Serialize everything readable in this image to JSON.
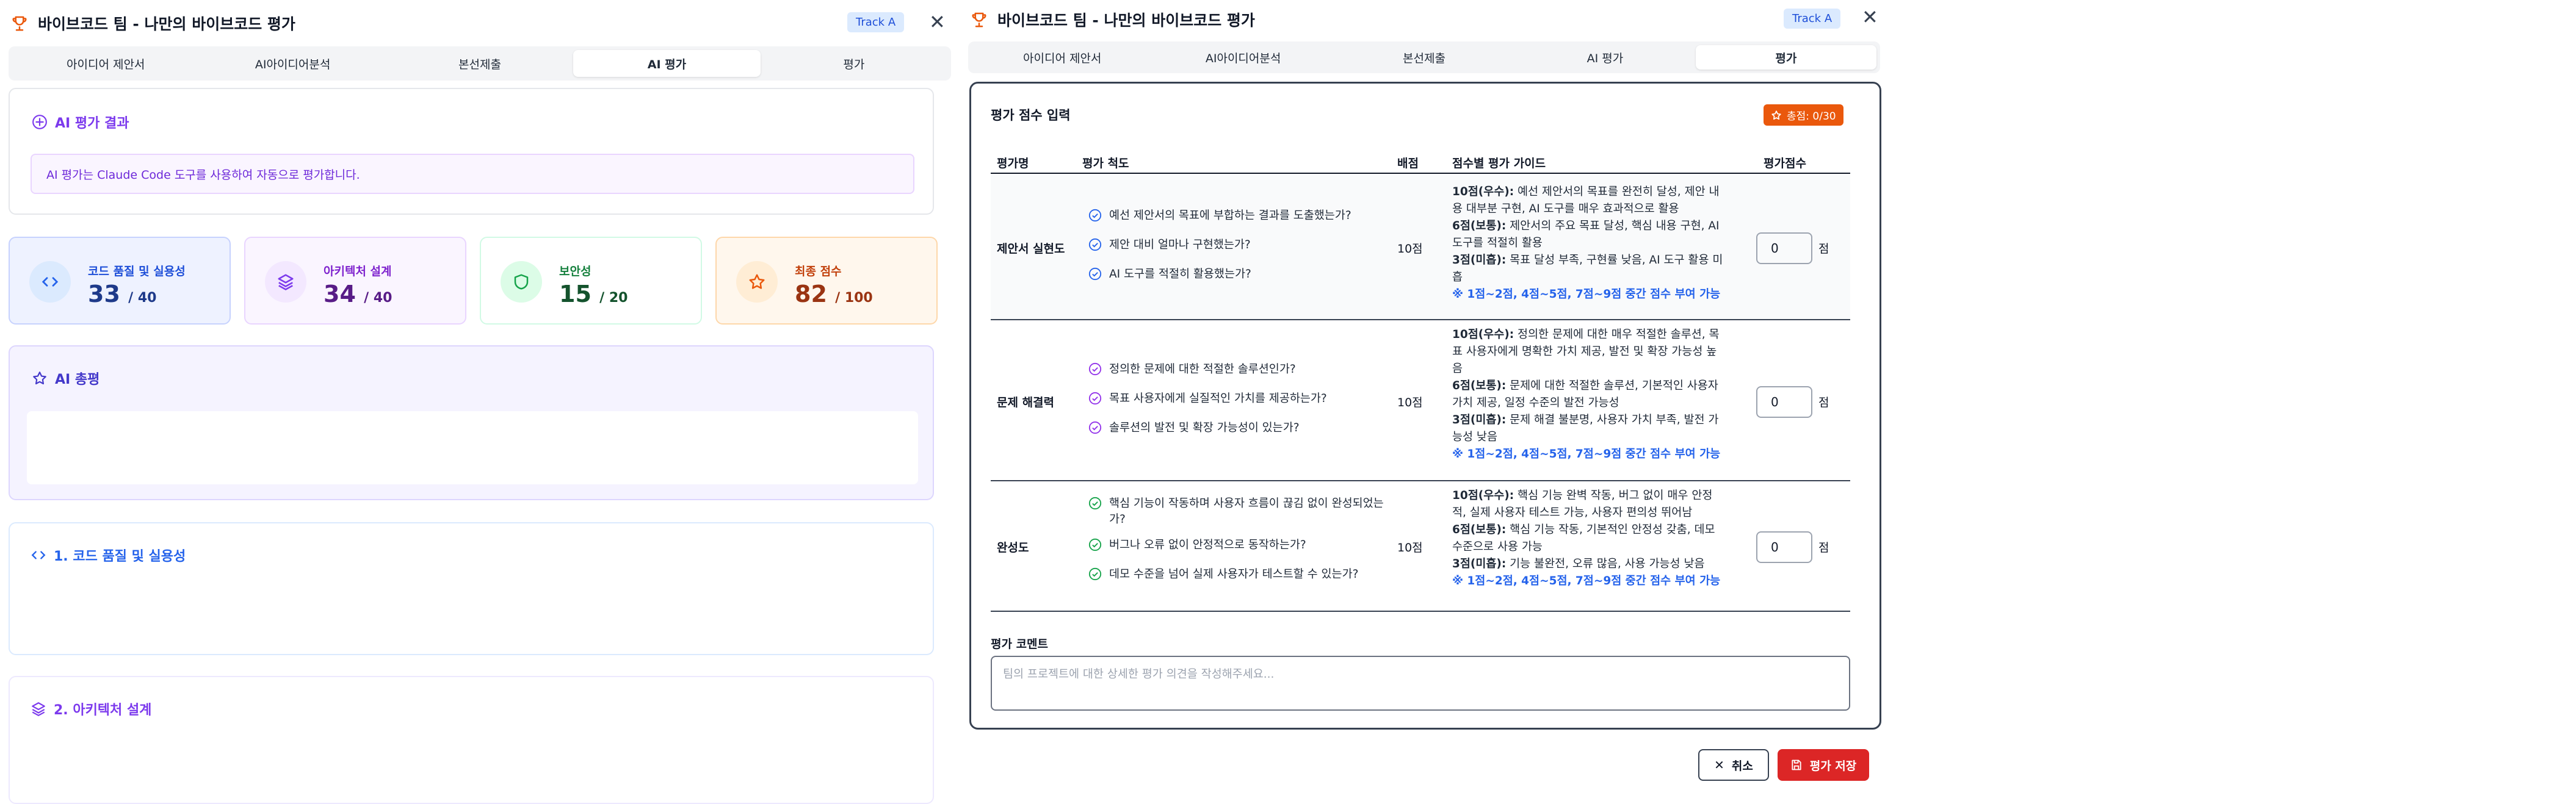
{
  "left": {
    "title": "바이브코드 팀 - 나만의 바이브코드 평가",
    "track": "Track A",
    "tabs": [
      "아이디어 제안서",
      "AI아이디어분석",
      "본선제출",
      "AI 평가",
      "평가"
    ],
    "ai_result": {
      "title": "AI 평가 결과",
      "notice": "AI 평가는 Claude Code 도구를 사용하여 자동으로 평가합니다."
    },
    "metrics": [
      {
        "label": "코드 품질 및 실용성",
        "value": "33",
        "max": "/ 40",
        "icon": "code-icon"
      },
      {
        "label": "아키텍처 설계",
        "value": "34",
        "max": "/ 40",
        "icon": "layers-icon"
      },
      {
        "label": "보안성",
        "value": "15",
        "max": "/ 20",
        "icon": "shield-icon"
      },
      {
        "label": "최종 점수",
        "value": "82",
        "max": "/ 100",
        "icon": "star-icon"
      }
    ],
    "summary_title": "AI 총평",
    "section1_title": "1. 코드 품질 및 실용성",
    "section2_title": "2. 아키텍처 설계"
  },
  "right": {
    "title": "바이브코드 팀 - 나만의 바이브코드 평가",
    "track": "Track A",
    "tabs": [
      "아이디어 제안서",
      "AI아이디어분석",
      "본선제출",
      "AI 평가",
      "평가"
    ],
    "form_title": "평가 점수 입력",
    "total_badge": "총점: 0/30",
    "columns": [
      "평가명",
      "평가 척도",
      "배점",
      "점수별 평가 가이드",
      "평가점수"
    ],
    "rows": [
      {
        "name": "제안서 실현도",
        "criteria": [
          "예선 제안서의 목표에 부합하는 결과를 도출했는가?",
          "제안 대비 얼마나 구현했는가?",
          "AI 도구를 적절히 활용했는가?"
        ],
        "points": "10점",
        "guide": [
          {
            "k": "10점(우수):",
            "t": " 예선 제안서의 목표를 완전히 달성, 제안 내용 대부분 구현, AI 도구를 매우 효과적으로 활용"
          },
          {
            "k": "6점(보통):",
            "t": " 제안서의 주요 목표 달성, 핵심 내용 구현, AI 도구를 적절히 활용"
          },
          {
            "k": "3점(미흡):",
            "t": " 목표 달성 부족, 구현률 낮음, AI 도구 활용 미흡"
          }
        ],
        "note": "※ 1점~2점, 4점~5점, 7점~9점 중간 점수 부여 가능",
        "score": "0",
        "unit": "점"
      },
      {
        "name": "문제 해결력",
        "criteria": [
          "정의한 문제에 대한 적절한 솔루션인가?",
          "목표 사용자에게 실질적인 가치를 제공하는가?",
          "솔루션의 발전 및 확장 가능성이 있는가?"
        ],
        "points": "10점",
        "guide": [
          {
            "k": "10점(우수):",
            "t": " 정의한 문제에 대한 매우 적절한 솔루션, 목표 사용자에게 명확한 가치 제공, 발전 및 확장 가능성 높음"
          },
          {
            "k": "6점(보통):",
            "t": " 문제에 대한 적절한 솔루션, 기본적인 사용자 가치 제공, 일정 수준의 발전 가능성"
          },
          {
            "k": "3점(미흡):",
            "t": " 문제 해결 불분명, 사용자 가치 부족, 발전 가능성 낮음"
          }
        ],
        "note": "※ 1점~2점, 4점~5점, 7점~9점 중간 점수 부여 가능",
        "score": "0",
        "unit": "점"
      },
      {
        "name": "완성도",
        "criteria": [
          "핵심 기능이 작동하며 사용자 흐름이 끊김 없이 완성되었는가?",
          "버그나 오류 없이 안정적으로 동작하는가?",
          "데모 수준을 넘어 실제 사용자가 테스트할 수 있는가?"
        ],
        "points": "10점",
        "guide": [
          {
            "k": "10점(우수):",
            "t": " 핵심 기능 완벽 작동, 버그 없이 매우 안정적, 실제 사용자 테스트 가능, 사용자 편의성 뛰어남"
          },
          {
            "k": "6점(보통):",
            "t": " 핵심 기능 작동, 기본적인 안정성 갖춤, 데모 수준으로 사용 가능"
          },
          {
            "k": "3점(미흡):",
            "t": " 기능 불완전, 오류 많음, 사용 가능성 낮음"
          }
        ],
        "note": "※ 1점~2점, 4점~5점, 7점~9점 중간 점수 부여 가능",
        "score": "0",
        "unit": "점"
      }
    ],
    "comment_label": "평가 코멘트",
    "comment_placeholder": "팀의 프로젝트에 대한 상세한 평가 의견을 작성해주세요...",
    "cancel_label": "취소",
    "save_label": "평가 저장"
  },
  "colors": {
    "accent_purple": "#7c3aed",
    "accent_orange": "#ea580c",
    "accent_blue": "#2563eb",
    "accent_green": "#16a34a",
    "save_red": "#dc2626"
  }
}
